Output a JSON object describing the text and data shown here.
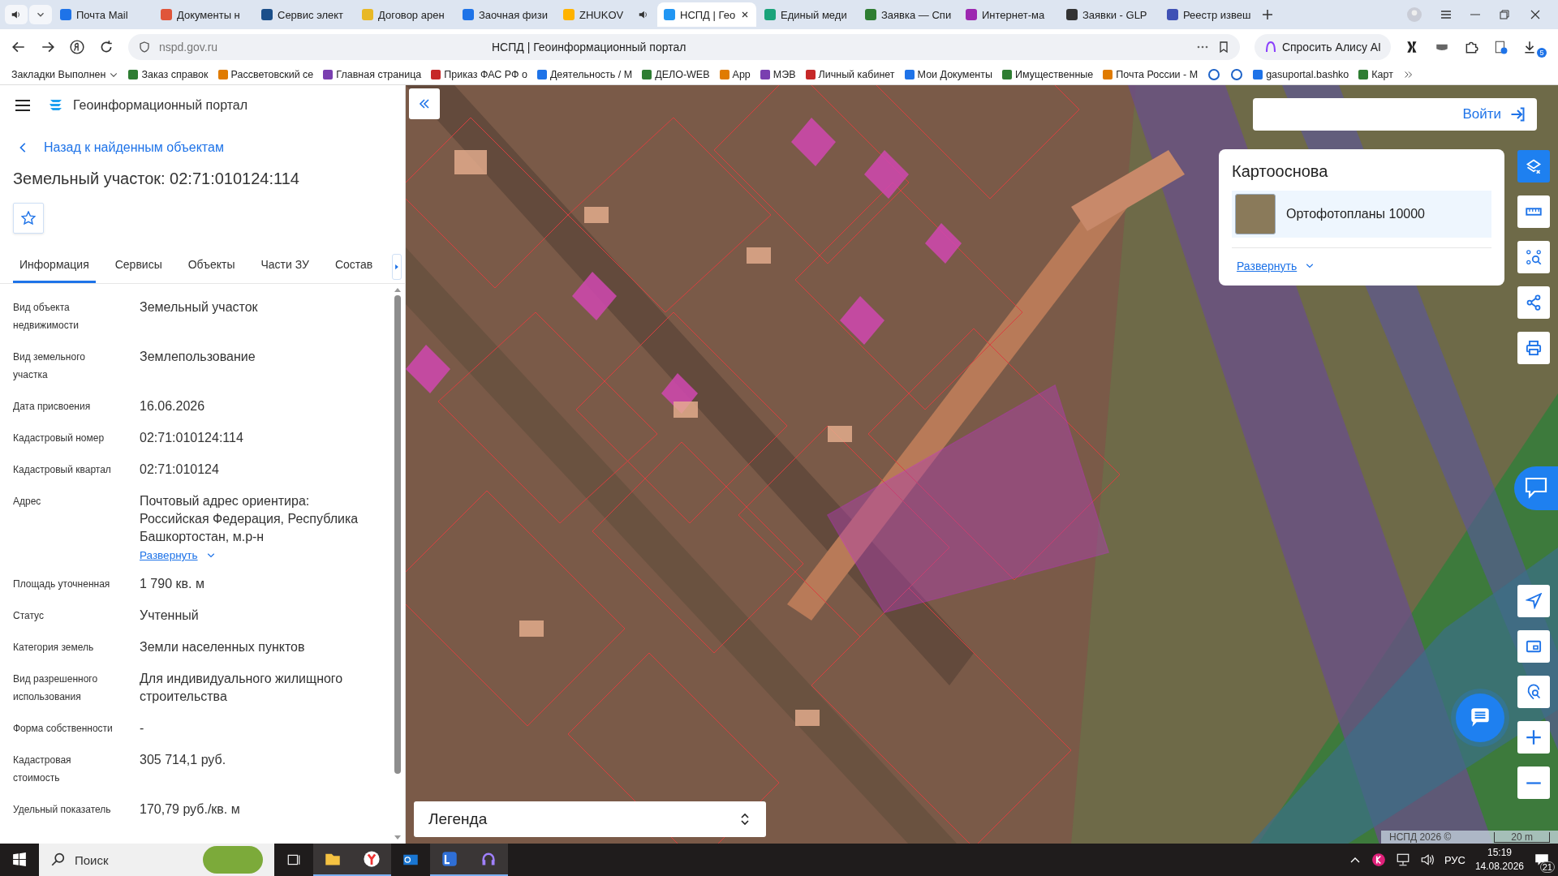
{
  "browser": {
    "tabs": [
      {
        "title": "Почта Mail",
        "selected": false,
        "playing": false
      },
      {
        "title": "Документы н",
        "selected": false,
        "playing": false
      },
      {
        "title": "Сервис элект",
        "selected": false,
        "playing": false
      },
      {
        "title": "Договор арен",
        "selected": false,
        "playing": false
      },
      {
        "title": "Заочная физи",
        "selected": false,
        "playing": false
      },
      {
        "title": "ZHUKOV",
        "selected": false,
        "playing": true
      },
      {
        "title": "НСПД | Гео",
        "selected": true,
        "playing": false
      },
      {
        "title": "Единый меди",
        "selected": false,
        "playing": false
      },
      {
        "title": "Заявка — Спи",
        "selected": false,
        "playing": false
      },
      {
        "title": "Интернет-ма",
        "selected": false,
        "playing": false
      },
      {
        "title": "Заявки - GLP",
        "selected": false,
        "playing": false
      },
      {
        "title": "Реестр извеш",
        "selected": false,
        "playing": false
      }
    ],
    "url": "nspd.gov.ru",
    "page_title": "НСПД | Геоинформационный портал",
    "assistant": "Спросить Алису AI",
    "downloads_badge": "5",
    "bookmarks": [
      {
        "kind": "folder",
        "label": "Закладки Выполнен"
      },
      {
        "kind": "link",
        "label": "Заказ справок"
      },
      {
        "kind": "link",
        "label": "Рассветовский се"
      },
      {
        "kind": "link",
        "label": "Главная страница"
      },
      {
        "kind": "link",
        "label": "Приказ ФАС РФ о"
      },
      {
        "kind": "link",
        "label": "Деятельность / М"
      },
      {
        "kind": "link",
        "label": "ДЕЛО-WEB"
      },
      {
        "kind": "link",
        "label": "App"
      },
      {
        "kind": "link",
        "label": "МЭВ"
      },
      {
        "kind": "link",
        "label": "Личный кабинет"
      },
      {
        "kind": "link",
        "label": "Мои Документы"
      },
      {
        "kind": "link",
        "label": "Имущественные"
      },
      {
        "kind": "link",
        "label": "Почта России - М"
      },
      {
        "kind": "icon"
      },
      {
        "kind": "icon"
      },
      {
        "kind": "link",
        "label": "gasuportal.bashko"
      },
      {
        "kind": "link",
        "label": "Карт"
      }
    ]
  },
  "panel": {
    "portal_title": "Геоинформационный портал",
    "back_link": "Назад к найденным объектам",
    "heading": "Земельный участок: 02:71:010124:114",
    "tabs": [
      {
        "label": "Информация",
        "selected": true
      },
      {
        "label": "Сервисы",
        "selected": false
      },
      {
        "label": "Объекты",
        "selected": false
      },
      {
        "label": "Части ЗУ",
        "selected": false
      },
      {
        "label": "Состав",
        "selected": false
      }
    ],
    "fields": [
      {
        "label": "Вид объекта недвижимости",
        "value": "Земельный участок"
      },
      {
        "label": "Вид земельного участка",
        "value": "Землепользование"
      },
      {
        "label": "Дата присвоения",
        "value": "16.06.2026"
      },
      {
        "label": "Кадастровый номер",
        "value": "02:71:010124:114"
      },
      {
        "label": "Кадастровый квартал",
        "value": "02:71:010124"
      },
      {
        "label": "Адрес",
        "value": "Почтовый адрес ориентира: Российская Федерация, Республика Башкортостан, м.р-н",
        "expand": "Развернуть"
      },
      {
        "label": "Площадь уточненная",
        "value": "1 790 кв. м"
      },
      {
        "label": "Статус",
        "value": "Учтенный"
      },
      {
        "label": "Категория земель",
        "value": "Земли населенных пунктов"
      },
      {
        "label": "Вид разрешенного использования",
        "value": "Для индивидуального жилищного строительства"
      },
      {
        "label": "Форма собственности",
        "value": "-"
      },
      {
        "label": "Кадастровая стоимость",
        "value": "305 714,1 руб."
      },
      {
        "label": "Удельный показатель",
        "value": "170,79 руб./кв. м"
      }
    ]
  },
  "map": {
    "login": "Войти",
    "basemap": {
      "title": "Картооснова",
      "layer": "Ортофотопланы 10000",
      "expand": "Развернуть"
    },
    "tools": [
      {
        "kind": "layers",
        "selected": true
      },
      {
        "kind": "ruler",
        "selected": false
      },
      {
        "kind": "select",
        "selected": false
      },
      {
        "kind": "share",
        "selected": false
      },
      {
        "kind": "print",
        "selected": false
      }
    ],
    "nav_tools": [
      {
        "kind": "locate"
      },
      {
        "kind": "minimap"
      },
      {
        "kind": "geosearch"
      },
      {
        "kind": "zoomin"
      },
      {
        "kind": "zoomout"
      }
    ],
    "legend": "Легенда",
    "attribution": "НСПД 2026 ©",
    "scale": "20 m"
  },
  "taskbar": {
    "search_placeholder": "Поиск",
    "language": "РУС",
    "time": "15:19",
    "date": "14.08.2026",
    "notifications": "21"
  }
}
